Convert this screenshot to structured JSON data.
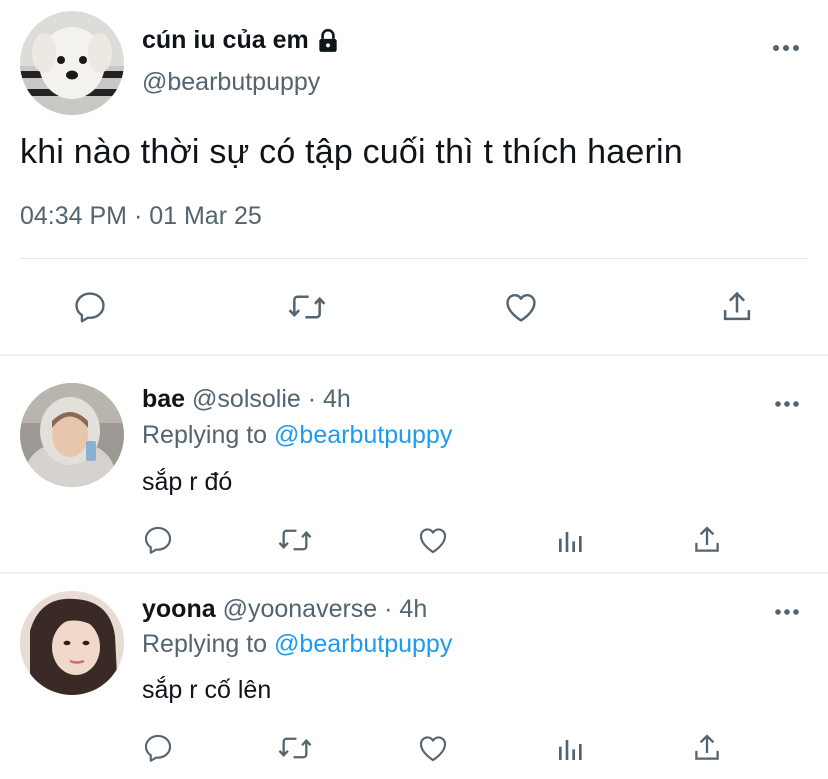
{
  "main_tweet": {
    "display_name": "cún iu của em",
    "handle": "@bearbutpuppy",
    "text": "khi nào thời sự có tập cuối thì t thích haerin",
    "timestamp": "04:34 PM · 01 Mar 25",
    "icons": [
      "lock-icon",
      "more-icon",
      "reply-icon",
      "retweet-icon",
      "like-icon",
      "share-icon"
    ]
  },
  "replies": [
    {
      "display_name": "bae",
      "meta": "@solsolie · 4h",
      "replying_label": "Replying to",
      "replying_handle": "@bearbutpuppy",
      "text": "sắp r đó"
    },
    {
      "display_name": "yoona",
      "meta": "@yoonaverse · 4h",
      "replying_label": "Replying to",
      "replying_handle": "@bearbutpuppy",
      "text": "sắp r cố lên"
    }
  ],
  "colors": {
    "text_primary": "#0f1419",
    "text_secondary": "#536471",
    "link_blue": "#1d9bf0",
    "divider": "#e1e6ea"
  }
}
